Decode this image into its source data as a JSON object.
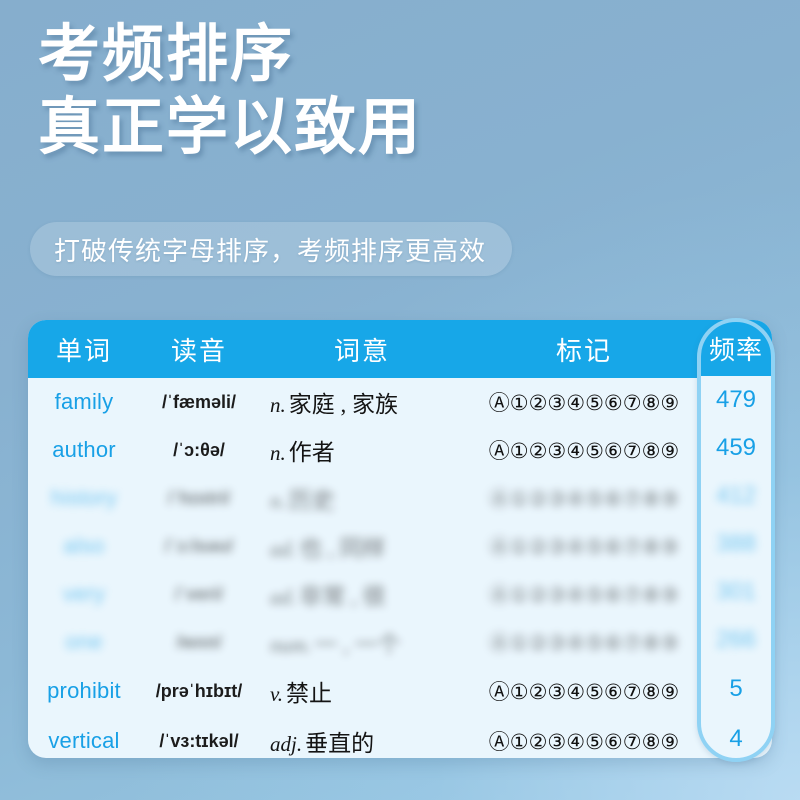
{
  "headline": {
    "line1": "考频排序",
    "line2": "真正学以致用"
  },
  "subtitle": {
    "text": "打破传统字母排序，考频排序更高效"
  },
  "colors": {
    "brand_blue": "#17a7e8",
    "accent_light": "#8fd2f4",
    "word_blue": "#18a0e6",
    "card_bg": "#eaf6fd",
    "page_bg_top": "#86aecd",
    "page_bg_bottom": "#9ccbe6"
  },
  "table": {
    "headers": {
      "word": "单词",
      "pronunciation": "读音",
      "meaning": "词意",
      "mark": "标记",
      "frequency": "频率"
    },
    "marker_glyphs": "Ⓐ①②③④⑤⑥⑦⑧⑨",
    "rows": [
      {
        "word": "family",
        "pron": "/ˈfæməli/",
        "pos": "n.",
        "zh": "家庭 , 家族",
        "marks": "Ⓐ①②③④⑤⑥⑦⑧⑨",
        "freq": "479",
        "blurred": false
      },
      {
        "word": "author",
        "pron": "/ˈɔ:θə/",
        "pos": "n.",
        "zh": "作者",
        "marks": "Ⓐ①②③④⑤⑥⑦⑧⑨",
        "freq": "459",
        "blurred": false
      },
      {
        "word": "history",
        "pron": "/ˈhɪstri/",
        "pos": "n.",
        "zh": "历史",
        "marks": "Ⓐ①②③④⑤⑥⑦⑧⑨",
        "freq": "412",
        "blurred": true
      },
      {
        "word": "also",
        "pron": "/ˈɔ:lsəʊ/",
        "pos": "ad.",
        "zh": "也 , 同样",
        "marks": "Ⓐ①②③④⑤⑥⑦⑧⑨",
        "freq": "388",
        "blurred": true
      },
      {
        "word": "very",
        "pron": "/ˈveri/",
        "pos": "ad.",
        "zh": "非常 , 很",
        "marks": "Ⓐ①②③④⑤⑥⑦⑧⑨",
        "freq": "301",
        "blurred": true
      },
      {
        "word": "one",
        "pron": "/wʌn/",
        "pos": "num.",
        "zh": "一 , 一个",
        "marks": "Ⓐ①②③④⑤⑥⑦⑧⑨",
        "freq": "266",
        "blurred": true
      },
      {
        "word": "prohibit",
        "pron": "/prəˈhɪbɪt/",
        "pos": "v.",
        "zh": "禁止",
        "marks": "Ⓐ①②③④⑤⑥⑦⑧⑨",
        "freq": "5",
        "blurred": false
      },
      {
        "word": "vertical",
        "pron": "/ˈvɜ:tɪkəl/",
        "pos": "adj.",
        "zh": "垂直的",
        "marks": "Ⓐ①②③④⑤⑥⑦⑧⑨",
        "freq": "4",
        "blurred": false
      }
    ]
  }
}
